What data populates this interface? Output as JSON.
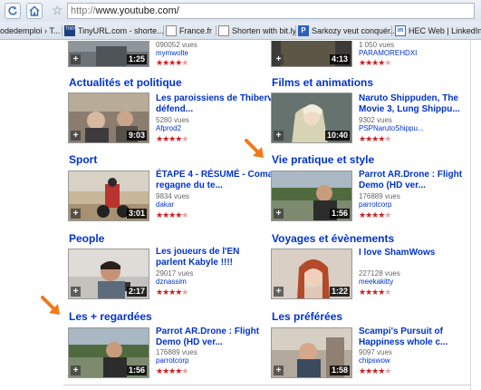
{
  "browser": {
    "url_protocol": "http://",
    "url_host": "www.youtube.com/",
    "bookmarks": [
      {
        "label": "odedemploi › T..."
      },
      {
        "label": "TinyURL.com - shorte...",
        "icon_text": "TINY URL"
      },
      {
        "label": "France.fr"
      },
      {
        "label": "Shorten with bit.ly"
      },
      {
        "label": "Sarkozy veut conquér...",
        "icon_text": "P"
      },
      {
        "label": "HEC Web | LinkedIn",
        "icon_text": "in"
      }
    ]
  },
  "top_row": {
    "left": {
      "views": "090052 vues",
      "channel": "mymwolte",
      "duration": "1:25"
    },
    "right": {
      "views": "1 050 vues",
      "channel": "PARAMOREHDXI",
      "duration": "4:13"
    }
  },
  "sections": {
    "actualites": {
      "title": "Actualités et politique",
      "video": {
        "title": "Les paroissiens de Thiberville défend...",
        "views": "5280 vues",
        "channel": "Afprod2",
        "duration": "9:03"
      }
    },
    "films": {
      "title": "Films et animations",
      "video": {
        "title": "Naruto Shippuden, The Movie 3, Lung Shippu...",
        "views": "9302 vues",
        "channel": "PSPNarutoShippu...",
        "duration": "10:40"
      }
    },
    "sport": {
      "title": "Sport",
      "video": {
        "title": "ÉTAPE 4 - RÉSUMÉ - Coma regagne du te...",
        "views": "9834 vues",
        "channel": "dakar",
        "duration": "3:01"
      }
    },
    "vie_pratique": {
      "title": "Vie pratique et style",
      "video": {
        "title": "Parrot AR.Drone : Flight Demo (HD ver...",
        "views": "176889 vues",
        "channel": "parrotcorp",
        "duration": "1:56"
      }
    },
    "people": {
      "title": "People",
      "video": {
        "title": "Les joueurs de l'EN parlent Kabyle !!!!",
        "views": "29017 vues",
        "channel": "dznassim",
        "duration": "2:17"
      }
    },
    "voyages": {
      "title": "Voyages et évènements",
      "video": {
        "title": "I love ShamWows",
        "views": "227128 vues",
        "channel": "meekakitty",
        "duration": "1:22"
      }
    },
    "regardees": {
      "title": "Les + regardées",
      "video": {
        "title": "Parrot AR.Drone : Flight Demo (HD ver...",
        "views": "176889 vues",
        "channel": "parrotcorp",
        "duration": "1:56"
      }
    },
    "preferees": {
      "title": "Les préférées",
      "video": {
        "title": "Scampi's Pursuit of Happiness whole c...",
        "views": "9097 vues",
        "channel": "chipswow",
        "duration": "1:58"
      }
    }
  },
  "ui": {
    "plus_glyph": "+",
    "stars_full": "★★★★",
    "stars_dim": "★",
    "accent_link": "#0033cc",
    "arrow_color": "#f07a1a"
  }
}
